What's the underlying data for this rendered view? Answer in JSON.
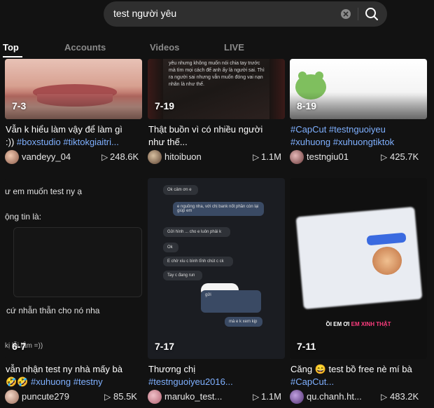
{
  "search": {
    "value": "test người yêu"
  },
  "tabs": [
    "Top",
    "Accounts",
    "Videos",
    "LIVE"
  ],
  "cards": [
    {
      "date": "7-3",
      "desc_plain": "Vẫn k hiểu làm vậy để làm gì",
      "desc_line2_plain": ":)) ",
      "desc_line2_tag": "#boxstudio #tiktokgiaitri...",
      "user": "vandeyy_04",
      "views": "248.6K"
    },
    {
      "date": "7-19",
      "desc_plain": "Thật buồn vì có nhiều người",
      "desc_line2_plain": "như thế...",
      "desc_line2_tag": "",
      "user": "hitoibuon",
      "views": "1.1M",
      "thumb_text": "yêu nhưng không muốn nói chia tay trước mà tìm mọi cách để anh ấy là người sai. Thì ra người sai nhưng vẫn muốn đóng vai nạn nhân là như thế."
    },
    {
      "date": "8-19",
      "desc_tag1": "#CapCut #testnguoiyeu",
      "desc_tag2": "#xuhuong #xuhuongtiktok",
      "user": "testngiu01",
      "views": "425.7K"
    },
    {
      "date": "6-7",
      "desc_plain": "vẫn nhận test ny nhà mấy bà",
      "desc_line2_plain": "🤣🤣 ",
      "desc_line2_tag": "#xuhuong #testny",
      "user": "puncute279",
      "views": "85.5K",
      "thumb_lines": [
        "ư em muốn test ny ạ",
        "ộng tin là:",
        "cứ nhẫn thẫn cho nó nha",
        "kị lỗi lắm =))"
      ]
    },
    {
      "date": "7-17",
      "desc_plain": "Thương chị",
      "desc_line2_plain": "",
      "desc_line2_tag": "#testnguoiyeu2016...",
      "user": "maruko_test...",
      "views": "1.1M",
      "chat": [
        "Ok cảm ơn e",
        "e nguồng nha, với chị bank nốt phần còn lại giúp em",
        "Gửi hình ... cho e luôn phải k",
        "Ok",
        "E chờ xíu c bình tĩnh chút c ck",
        "Tay c đang run",
        "gửi",
        "mà e k xem kịp"
      ]
    },
    {
      "date": "7-11",
      "desc_plain": "Căng 😄 test bồ free nè mí bà",
      "desc_line2_plain": "",
      "desc_line2_tag": "#CapCut...",
      "user": "qu.chanh.ht...",
      "views": "483.2K",
      "thumb_caption_plain": "ỒI EM ƠI ",
      "thumb_caption_accent": "EM XINH THẬT"
    }
  ],
  "colors": {
    "background": "#121212",
    "hashtag": "#7fb0ff",
    "accent_pink": "#ff3d7f"
  }
}
